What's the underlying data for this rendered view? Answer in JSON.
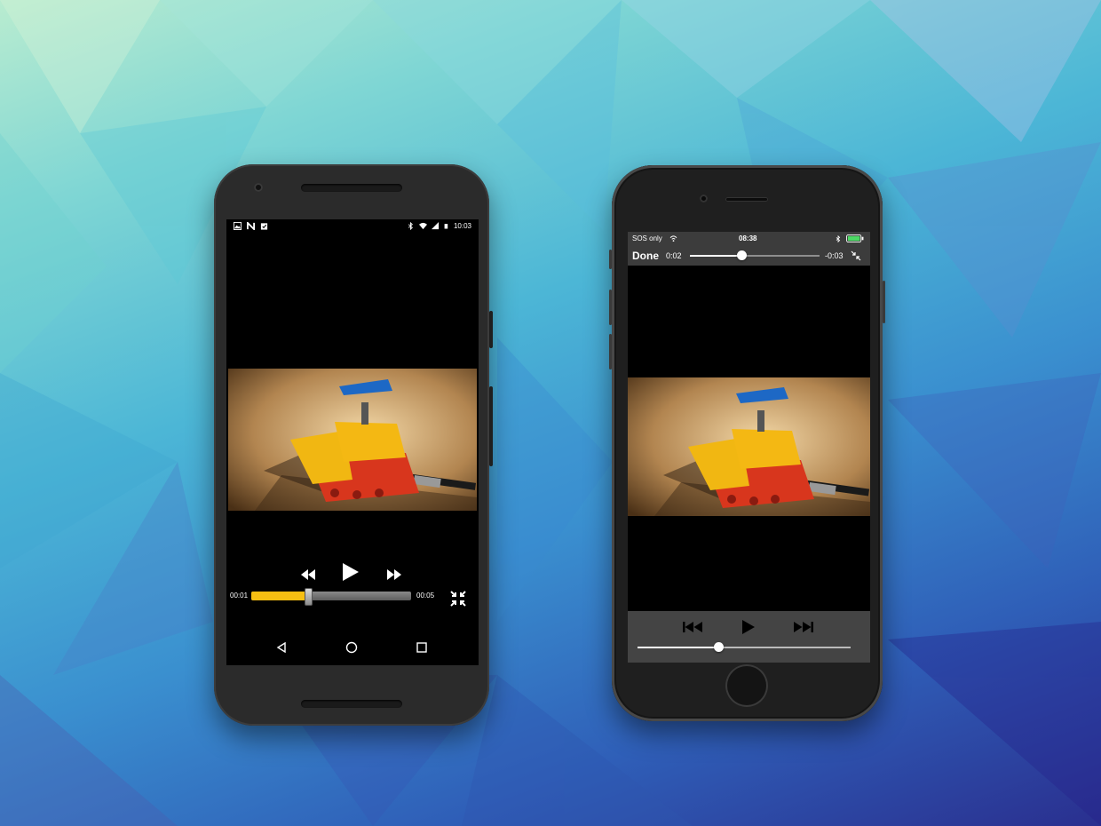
{
  "android": {
    "status_bar": {
      "time": "10:03",
      "left_icons": [
        "image-icon",
        "n-icon",
        "clipboard-check-icon"
      ],
      "right_icons": [
        "bluetooth-icon",
        "wifi-icon",
        "signal-icon",
        "battery-icon"
      ]
    },
    "player": {
      "current_time": "00:01",
      "duration": "00:05",
      "progress": 0.35,
      "accent_color": "#f7bf12",
      "controls": [
        "rewind-icon",
        "play-icon",
        "fast-forward-icon",
        "fullscreen-exit-icon"
      ]
    },
    "nav_bar": [
      "back-icon",
      "home-icon",
      "recents-icon"
    ]
  },
  "iphone": {
    "status_bar": {
      "carrier": "SOS only",
      "time": "08:38",
      "battery_color": "#4cd964"
    },
    "top_bar": {
      "done_label": "Done",
      "elapsed": "0:02",
      "remaining": "-0:03",
      "progress": 0.4
    },
    "bottom_controls": {
      "controls": [
        "skip-back-icon",
        "play-icon",
        "skip-forward-icon"
      ],
      "volume": 0.38
    }
  }
}
